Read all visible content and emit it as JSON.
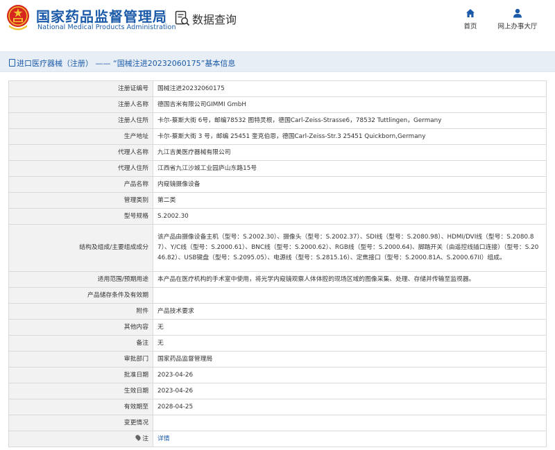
{
  "header": {
    "org_name_cn": "国家药品监督管理局",
    "org_name_en": "National Medical Products Administration",
    "page_title": "数据查询",
    "nav": [
      {
        "label": "首页",
        "icon": "home-icon"
      },
      {
        "label": "网上办事大厅",
        "icon": "user-icon"
      }
    ]
  },
  "colors": {
    "brand_blue": "#1a5aa8",
    "emblem_red": "#d7261e",
    "emblem_gold": "#f1c232",
    "banner_bg": "#e8eef6"
  },
  "breadcrumb": {
    "category": "进口医疗器械（注册）",
    "separator": "——",
    "record_title": "“国械注进20232060175”基本信息"
  },
  "record": {
    "rows": [
      {
        "label": "注册证编号",
        "value": "国械注进20232060175"
      },
      {
        "label": "注册人名称",
        "value": "德国吉米有限公司GIMMI GmbH"
      },
      {
        "label": "注册人住所",
        "value": "卡尔-蔡斯大街 6号，邮编78532 图特灵根，德国Carl-Zeiss-Strasse6，78532 Tuttlingen，Germany"
      },
      {
        "label": "生产地址",
        "value": "卡尔-蔡斯大街 3 号，邮编 25451 奎克伯恩，德国Carl-Zeiss-Str.3 25451 Quickborn,Germany"
      },
      {
        "label": "代理人名称",
        "value": "九江吉美医疗器械有限公司"
      },
      {
        "label": "代理人住所",
        "value": "江西省九江沙城工业园庐山东路15号"
      },
      {
        "label": "产品名称",
        "value": "内窥镜摄像设备"
      },
      {
        "label": "管理类别",
        "value": "第二类"
      },
      {
        "label": "型号规格",
        "value": "S.2002.30"
      },
      {
        "label": "结构及组成/主要组成成分",
        "value": "该产品由摄像设备主机（型号：S.2002.30）、摄像头（型号：S.2002.37）、SDI线（型号：S.2080.98）、HDMI/DVI线（型号：S.2080.87）、Y/C线（型号：S.2000.61）、BNC线（型号：S.2000.62）、RGB线（型号：S.2000.64)、脚踏开关（由遥控线插口连接）（型号：S.2046.82）、USB键盘（型号：S.2095.05）、电源线（型号：S.2815.16）、定焦接口（型号：S.2000.81A、S.2000.67II）组成。"
      },
      {
        "label": "适用范围/预期用途",
        "value": "本产品在医疗机构的手术室中使用，将光学内窥镜观察人体体腔的现场区域的图像采集、处理、存储并传输至监视器。"
      },
      {
        "label": "产品储存条件及有效期",
        "value": ""
      },
      {
        "label": "附件",
        "value": "产品技术要求"
      },
      {
        "label": "其他内容",
        "value": "无"
      },
      {
        "label": "备注",
        "value": "无"
      },
      {
        "label": "审批部门",
        "value": "国家药品监督管理局"
      },
      {
        "label": "批准日期",
        "value": "2023-04-26"
      },
      {
        "label": "生效日期",
        "value": "2023-04-26"
      },
      {
        "label": "有效期至",
        "value": "2028-04-25"
      },
      {
        "label": "变更情况",
        "value": ""
      },
      {
        "label": "注",
        "value": "详情",
        "icon": "pin-icon"
      }
    ]
  }
}
